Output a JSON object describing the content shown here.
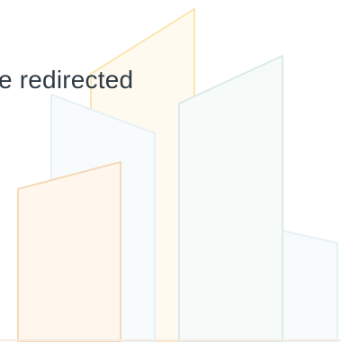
{
  "message": {
    "text": "e redirected"
  },
  "colors": {
    "text": "#2f3a45",
    "orange_line": "#f7d9b8",
    "yellow_line": "#fbe6b2",
    "teal_line": "#dbe9e8",
    "blue_line": "#e6f1f5",
    "orange_fill": "#fff4e8",
    "yellow_fill": "#fff8e6",
    "teal_fill": "#f2f8f7",
    "blue_fill": "#f4f9fb"
  }
}
